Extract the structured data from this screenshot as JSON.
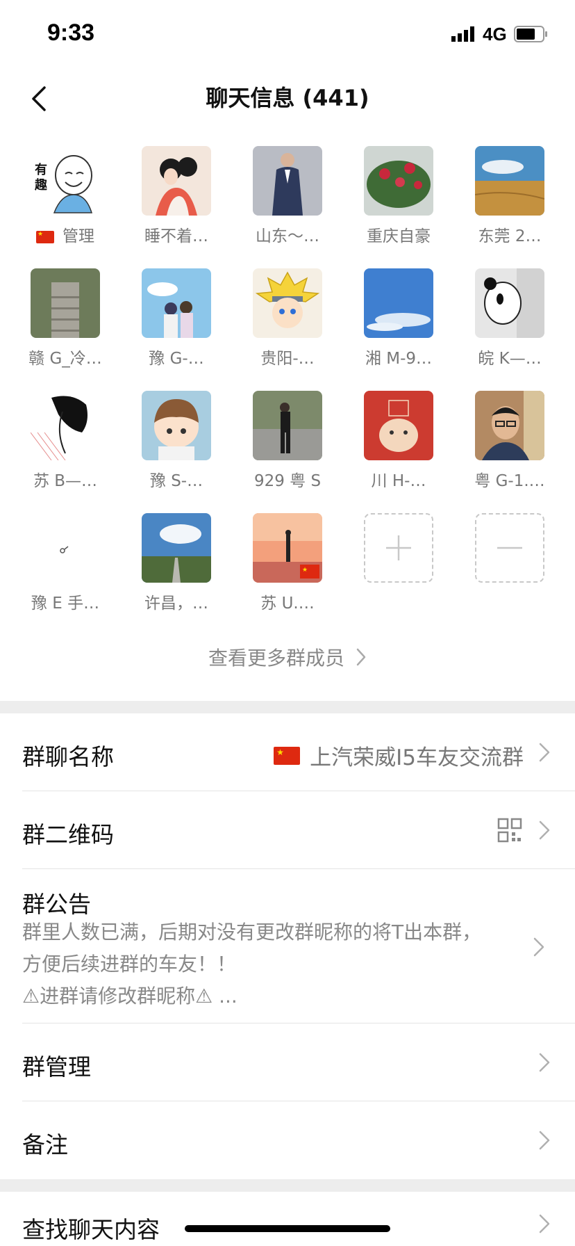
{
  "status_bar": {
    "time": "9:33",
    "network": "4G"
  },
  "nav": {
    "title": "聊天信息 (441)"
  },
  "members": [
    {
      "name": "管理",
      "flag": true,
      "avatar": "meme-face"
    },
    {
      "name": "睡不着…",
      "avatar": "couple-illustration"
    },
    {
      "name": "山东～…",
      "avatar": "man-in-suit"
    },
    {
      "name": "重庆自豪",
      "avatar": "rose-plant"
    },
    {
      "name": "东莞 2…",
      "avatar": "wheat-field"
    },
    {
      "name": "赣 G_冷…",
      "avatar": "stone-stairs"
    },
    {
      "name": "豫 G-…",
      "avatar": "anime-couple"
    },
    {
      "name": "贵阳-…",
      "avatar": "naruto-chibi"
    },
    {
      "name": "湘 M-9…",
      "avatar": "blue-sky"
    },
    {
      "name": "皖 K—…",
      "avatar": "panda"
    },
    {
      "name": "苏 B—…",
      "avatar": "sketch-boy"
    },
    {
      "name": "豫 S-…",
      "avatar": "cartoon-boy"
    },
    {
      "name": "929 粤 S",
      "avatar": "man-standing"
    },
    {
      "name": "川 H-…",
      "avatar": "red-hamster"
    },
    {
      "name": "粤 G-1.…",
      "avatar": "man-glasses"
    },
    {
      "name": "豫 E 手…",
      "avatar": "tiny-doodle"
    },
    {
      "name": "许昌，…",
      "avatar": "sky-road"
    },
    {
      "name": "苏 U.…",
      "avatar": "sunset-person"
    }
  ],
  "grid_actions": {
    "add": "add-member",
    "remove": "remove-member"
  },
  "more_members_label": "查看更多群成员",
  "rows": {
    "group_name": {
      "label": "群聊名称",
      "value": "上汽荣威I5车友交流群"
    },
    "qr_code": {
      "label": "群二维码"
    },
    "notice": {
      "label": "群公告",
      "line1": "群里人数已满，后期对没有更改群昵称的将T出本群，",
      "line2": "方便后续进群的车友！！",
      "line3": "⚠进群请修改群昵称⚠ ..."
    },
    "manage": {
      "label": "群管理"
    },
    "remark": {
      "label": "备注"
    },
    "search": {
      "label": "查找聊天内容"
    }
  }
}
